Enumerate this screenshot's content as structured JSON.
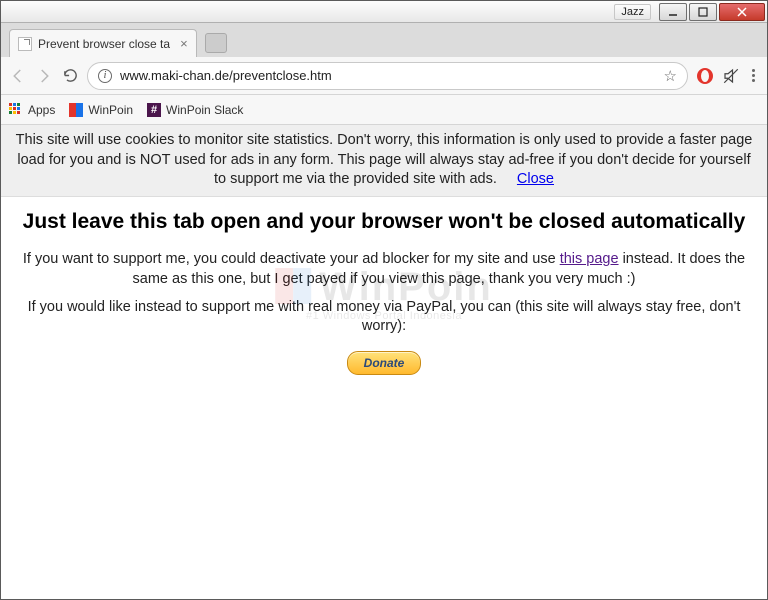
{
  "window": {
    "caption": "Jazz"
  },
  "tab": {
    "title": "Prevent browser close ta"
  },
  "address": {
    "url": "www.maki-chan.de/preventclose.htm"
  },
  "bookmarks": {
    "apps": "Apps",
    "winpoin": "WinPoin",
    "slack": "WinPoin Slack"
  },
  "cookie_notice": {
    "text": "This site will use cookies to monitor site statistics. Don't worry, this information is only used to provide a faster page load for you and is NOT used for ads in any form. This page will always stay ad-free if you don't decide for yourself to support me via the provided site with ads.",
    "close": "Close"
  },
  "page": {
    "heading": "Just leave this tab open and your browser won't be closed automatically",
    "p1_pre": "If you want to support me, you could deactivate your ad blocker for my site and use ",
    "p1_link": "this page",
    "p1_post": " instead. It does the same as this one, but I get payed if you view this page, thank you very much :)",
    "p2": "If you would like instead to support me with real money via PayPal, you can (this site will always stay free, don't worry):",
    "donate": "Donate"
  },
  "watermark": {
    "brand": "WinPoin",
    "tagline": "#1 Windows Portal Indonesia"
  }
}
